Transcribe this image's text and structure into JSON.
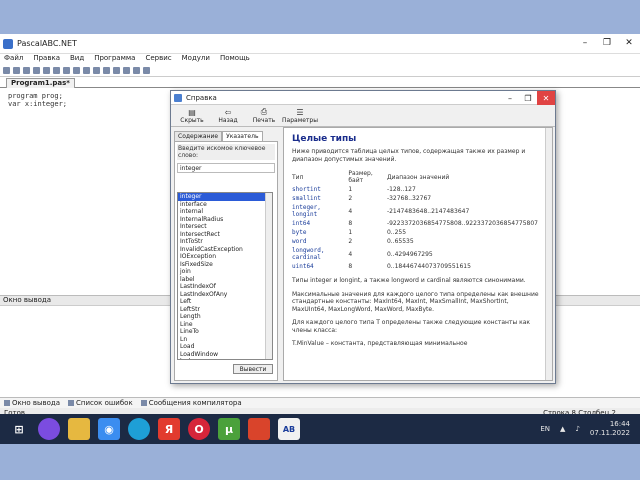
{
  "app": {
    "title": "PascalABC.NET",
    "controls": [
      "–",
      "❐",
      "✕"
    ]
  },
  "menu": [
    "Файл",
    "Правка",
    "Вид",
    "Программа",
    "Сервис",
    "Модули",
    "Помощь"
  ],
  "file_tab": "Program1.pas*",
  "editor_lines": [
    "program prog;",
    "  var x:integer;"
  ],
  "output": {
    "header": "Окно вывода"
  },
  "bottom_tabs": [
    "Окно вывода",
    "Список ошибок",
    "Сообщения компилятора"
  ],
  "status": {
    "left": "Готов",
    "right": "Строка 8  Столбец 2"
  },
  "help": {
    "title": "Справка",
    "toolbar": [
      "Скрыть",
      "Назад",
      "Печать",
      "Параметры"
    ],
    "left_tabs": [
      "Содержание",
      "Указатель"
    ],
    "prompt": "Введите искомое ключевое слово:",
    "keyword": "integer",
    "index_items": [
      "integer",
      "interface",
      "internal",
      "InternalRadius",
      "Intersect",
      "IntersectRect",
      "IntToStr",
      "InvalidCastException",
      "IOException",
      "IsFixedSize",
      "join",
      "label",
      "LastIndexOf",
      "LastIndexOfAny",
      "Left",
      "LeftStr",
      "Length",
      "Line",
      "LineTo",
      "Ln",
      "Load",
      "LoadWindow",
      "lock"
    ],
    "show_button": "Вывести",
    "heading": "Целые типы",
    "intro": "Ниже приводится таблица целых типов, содержащая также их размер и диапазон допустимых значений.",
    "table_headers": [
      "Тип",
      "Размер, байт",
      "Диапазон значений"
    ],
    "table_rows": [
      [
        "shortint",
        "1",
        "-128..127"
      ],
      [
        "smallint",
        "2",
        "-32768..32767"
      ],
      [
        "integer, longint",
        "4",
        "-2147483648..2147483647"
      ],
      [
        "int64",
        "8",
        "-9223372036854775808..9223372036854775807"
      ],
      [
        "byte",
        "1",
        "0..255"
      ],
      [
        "word",
        "2",
        "0..65535"
      ],
      [
        "longword, cardinal",
        "4",
        "0..4294967295"
      ],
      [
        "uint64",
        "8",
        "0..18446744073709551615"
      ]
    ],
    "p2": "Типы integer и longint, а также longword и cardinal являются синонимами.",
    "p3": "Максимальные значения для каждого целого типа определены как внешние стандартные константы: MaxInt64, MaxInt, MaxSmallInt, MaxShortInt, MaxUInt64, MaxLongWord, MaxWord, MaxByte.",
    "p4": "Для каждого целого типа T определены также следующие константы как члены класса:",
    "p5": "T.MinValue – константа, представляющая минимальное"
  },
  "taskbar": {
    "icons": [
      "windows-logo",
      "alice",
      "explorer",
      "chrome",
      "edge",
      "yandex",
      "opera",
      "utorrent",
      "office",
      "pascalabc"
    ],
    "lang": "EN",
    "time": "16:44",
    "date": "07.11.2022"
  }
}
